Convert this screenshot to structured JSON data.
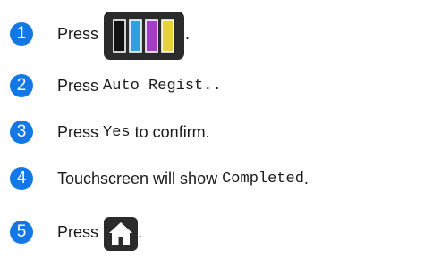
{
  "steps": [
    {
      "number": "1",
      "text_before": "Press",
      "icon": "ink-cartridge-icon",
      "text_after": "."
    },
    {
      "number": "2",
      "text_before": "Press",
      "code": "Auto Regist.",
      "text_after": "."
    },
    {
      "number": "3",
      "text_before": "Press",
      "code": "Yes",
      "text_after": "to confirm."
    },
    {
      "number": "4",
      "text_before": "Touchscreen will show",
      "code": "Completed",
      "text_after": "."
    },
    {
      "number": "5",
      "text_before": "Press",
      "icon": "home-icon",
      "text_after": "."
    }
  ],
  "colors": {
    "badge": "#1477e6",
    "icon_bg": "#2b2b2b",
    "ink_black": "#111111",
    "ink_cyan": "#2fa0e0",
    "ink_magenta": "#a13fc6",
    "ink_yellow": "#e8d23a"
  }
}
